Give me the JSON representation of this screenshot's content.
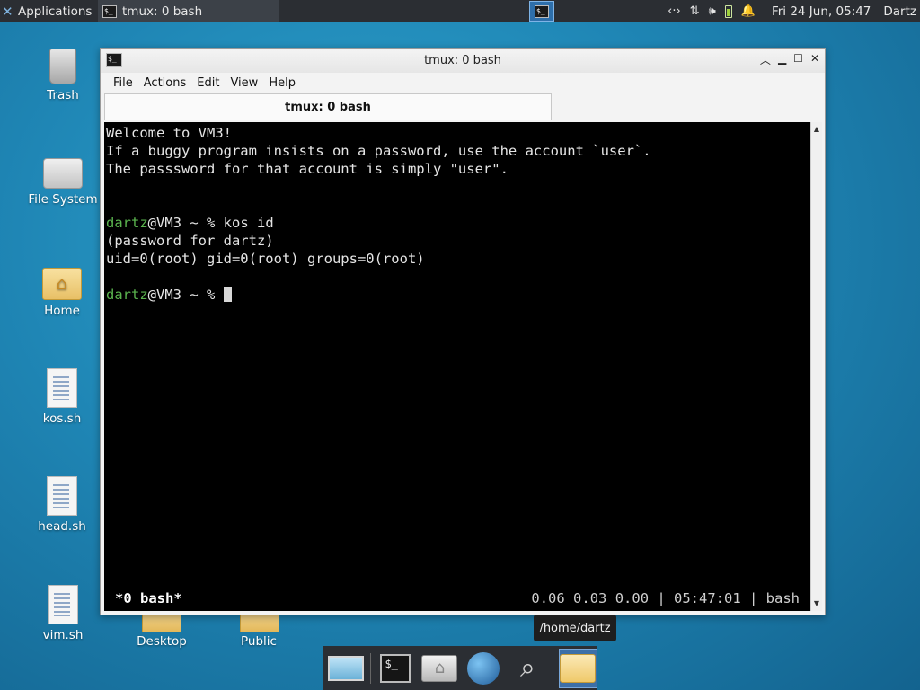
{
  "top_panel": {
    "applications_label": "Applications",
    "task_title": "tmux: 0 bash",
    "clock": "Fri 24 Jun, 05:47",
    "user": "Dartz",
    "tray_icons": [
      "network-arrows-icon",
      "transfer-icon",
      "volume-icon",
      "battery-icon",
      "bell-icon"
    ]
  },
  "desktop": {
    "icons": [
      {
        "label": "Trash"
      },
      {
        "label": "File System"
      },
      {
        "label": "Home"
      },
      {
        "label": "kos.sh"
      },
      {
        "label": "head.sh"
      },
      {
        "label": "vim.sh"
      },
      {
        "label": "Desktop"
      },
      {
        "label": "Public"
      }
    ]
  },
  "window": {
    "title": "tmux: 0 bash",
    "menu": [
      "File",
      "Actions",
      "Edit",
      "View",
      "Help"
    ],
    "tab_label": "tmux: 0 bash",
    "terminal": {
      "lines": [
        "Welcome to VM3!",
        "If a buggy program insists on a password, use the account `user`.",
        "The passsword for that account is simply \"user\"."
      ],
      "prompt_user": "dartz",
      "prompt_rest": "@VM3 ~ % ",
      "command": "kos id",
      "output": [
        "(password for dartz)",
        "uid=0(root) gid=0(root) groups=0(root)"
      ]
    },
    "status_left": "*0 bash*",
    "status_right": "0.06 0.03 0.00 | 05:47:01 | bash"
  },
  "tooltip": "/home/dartz",
  "dock": [
    "show-desktop-icon",
    "terminal-icon",
    "home-folder-icon",
    "web-browser-icon",
    "search-icon",
    "file-manager-icon"
  ]
}
